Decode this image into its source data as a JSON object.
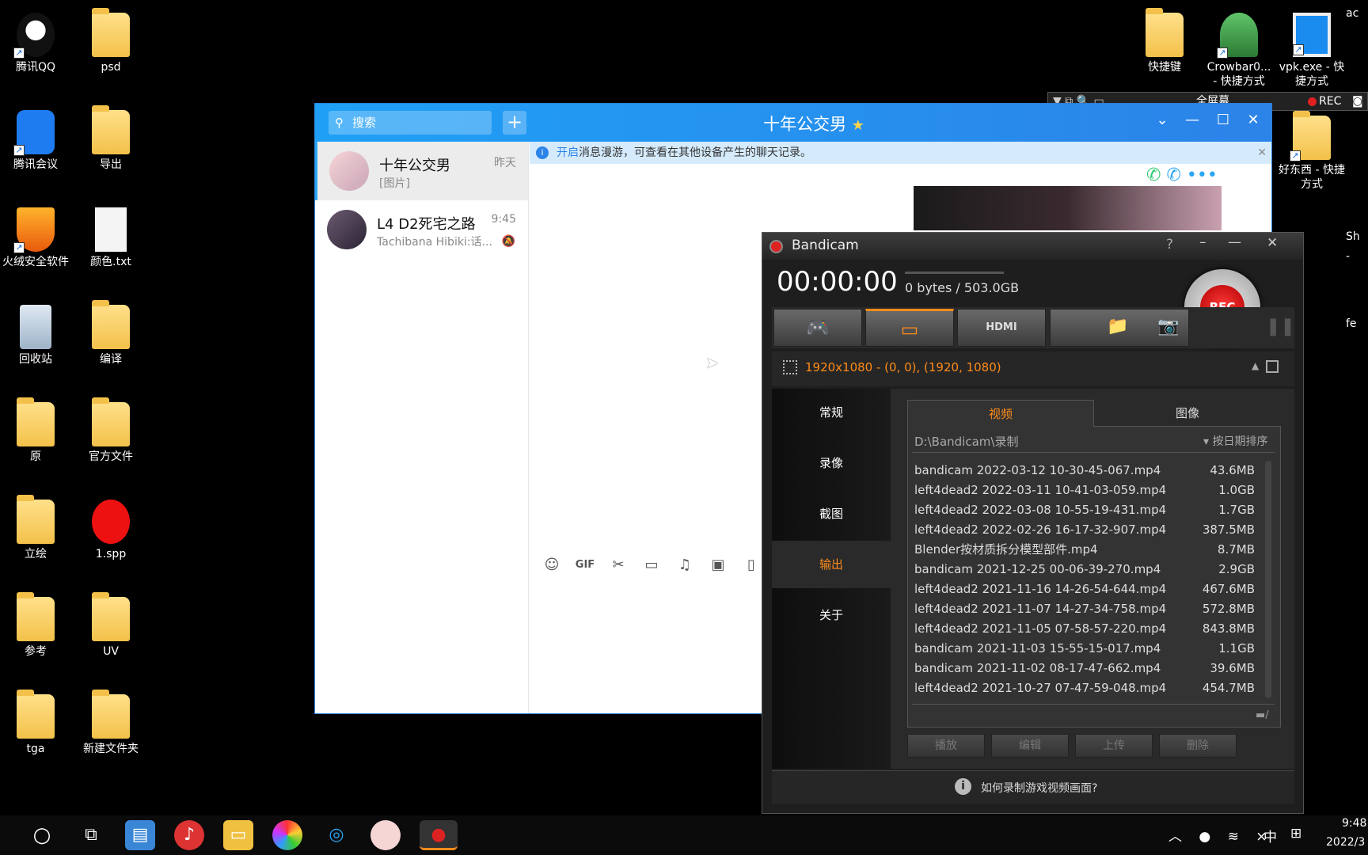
{
  "desktop_icons_left": [
    {
      "label": "腾讯QQ"
    },
    {
      "label": "psd"
    },
    {
      "label": "腾讯会议"
    },
    {
      "label": "导出"
    },
    {
      "label": "火绒安全软件"
    },
    {
      "label": "颜色.txt"
    },
    {
      "label": "回收站"
    },
    {
      "label": "编译"
    },
    {
      "label": "原"
    },
    {
      "label": "官方文件"
    },
    {
      "label": "立绘"
    },
    {
      "label": "1.spp"
    },
    {
      "label": "参考"
    },
    {
      "label": "UV"
    },
    {
      "label": "tga"
    },
    {
      "label": "新建文件夹"
    }
  ],
  "desktop_icons_right": [
    {
      "label": "快捷键"
    },
    {
      "label": "Crowbar0...\n- 快捷方式"
    },
    {
      "label": "vpk.exe - 快\n捷方式"
    },
    {
      "label": "好东西 - 快捷\n方式"
    },
    {
      "label": "ac"
    },
    {
      "label": "Sh"
    },
    {
      "label": "-"
    },
    {
      "label": "fe"
    }
  ],
  "rec_overlay": {
    "label": "全屏幕",
    "rec": "REC"
  },
  "qq": {
    "search_placeholder": "搜索",
    "plus": "+",
    "title": "十年公交男",
    "chats": [
      {
        "name": "十年公交男",
        "msg": "[图片]",
        "time": "昨天"
      },
      {
        "name": "L4 D2死宅之路",
        "msg": "Tachibana Hibiki:话...",
        "time": "9:45"
      }
    ],
    "notice_link": "开启",
    "notice_text": "消息漫游，可查看在其他设备产生的聊天记录。"
  },
  "bandicam": {
    "title": "Bandicam",
    "help": "?",
    "timer": "00:00:00",
    "storage": "0 bytes / 503.0GB",
    "rec_label": "REC",
    "region": "1920x1080 - (0, 0), (1920, 1080)",
    "sidebar": [
      "常规",
      "录像",
      "截图",
      "输出",
      "关于"
    ],
    "active_side": "输出",
    "tabs": [
      "视频",
      "图像"
    ],
    "path": "D:\\Bandicam\\录制",
    "sort": "按日期排序",
    "files": [
      {
        "name": "bandicam 2022-03-12 10-30-45-067.mp4",
        "size": "43.6MB"
      },
      {
        "name": "left4dead2 2022-03-11 10-41-03-059.mp4",
        "size": "1.0GB"
      },
      {
        "name": "left4dead2 2022-03-08 10-55-19-431.mp4",
        "size": "1.7GB"
      },
      {
        "name": "left4dead2 2022-02-26 16-17-32-907.mp4",
        "size": "387.5MB"
      },
      {
        "name": "Blender按材质拆分模型部件.mp4",
        "size": "8.7MB"
      },
      {
        "name": "bandicam 2021-12-25 00-06-39-270.mp4",
        "size": "2.9GB"
      },
      {
        "name": "left4dead2 2021-11-16 14-26-54-644.mp4",
        "size": "467.6MB"
      },
      {
        "name": "left4dead2 2021-11-07 14-27-34-758.mp4",
        "size": "572.8MB"
      },
      {
        "name": "left4dead2 2021-11-05 07-58-57-220.mp4",
        "size": "843.8MB"
      },
      {
        "name": "bandicam 2021-11-03 15-55-15-017.mp4",
        "size": "1.1GB"
      },
      {
        "name": "bandicam 2021-11-02 08-17-47-662.mp4",
        "size": "39.6MB"
      },
      {
        "name": "left4dead2 2021-10-27 07-47-59-048.mp4",
        "size": "454.7MB"
      }
    ],
    "actions": [
      "播放",
      "编辑",
      "上传",
      "删除"
    ],
    "footer": "如何录制游戏视频画面?"
  },
  "taskbar": {
    "ime": "中",
    "time": "9:48",
    "date": "2022/3"
  }
}
